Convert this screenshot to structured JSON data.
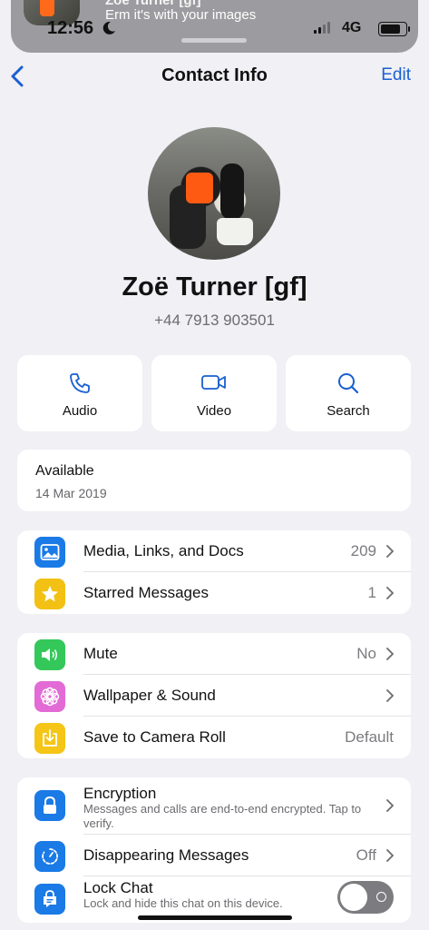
{
  "banner": {
    "title": "Zoë Turner [gf]",
    "message": "Erm it's with your images",
    "time": "12:56",
    "network": "4G"
  },
  "header": {
    "title": "Contact Info",
    "edit_label": "Edit"
  },
  "contact": {
    "name": "Zoë Turner [gf]",
    "phone": "+44 7913 903501"
  },
  "actions": [
    {
      "label": "Audio",
      "icon": "phone-icon"
    },
    {
      "label": "Video",
      "icon": "video-camera-icon"
    },
    {
      "label": "Search",
      "icon": "search-icon"
    }
  ],
  "status": {
    "text": "Available",
    "date": "14 Mar 2019"
  },
  "media_group": [
    {
      "label": "Media, Links, and Docs",
      "value": "209",
      "icon": "photo-icon",
      "color": "#1a7ae6"
    },
    {
      "label": "Starred Messages",
      "value": "1",
      "icon": "star-icon",
      "color": "#f2c114"
    }
  ],
  "settings_group": [
    {
      "label": "Mute",
      "value": "No",
      "icon": "speaker-icon",
      "color": "#34c759"
    },
    {
      "label": "Wallpaper & Sound",
      "value": "",
      "icon": "flower-icon",
      "color": "#e26bd6"
    },
    {
      "label": "Save to Camera Roll",
      "value": "Default",
      "icon": "download-icon",
      "color": "#f5c518"
    }
  ],
  "privacy_group": [
    {
      "label": "Encryption",
      "sub": "Messages and calls are end-to-end encrypted. Tap to verify.",
      "icon": "lock-icon",
      "color": "#1a7ae6"
    },
    {
      "label": "Disappearing Messages",
      "value": "Off",
      "icon": "timer-icon",
      "color": "#1a7ae6"
    },
    {
      "label": "Lock Chat",
      "sub": "Lock and hide this chat on this device.",
      "icon": "lock-chat-icon",
      "color": "#1a7ae6",
      "toggle": false
    }
  ]
}
